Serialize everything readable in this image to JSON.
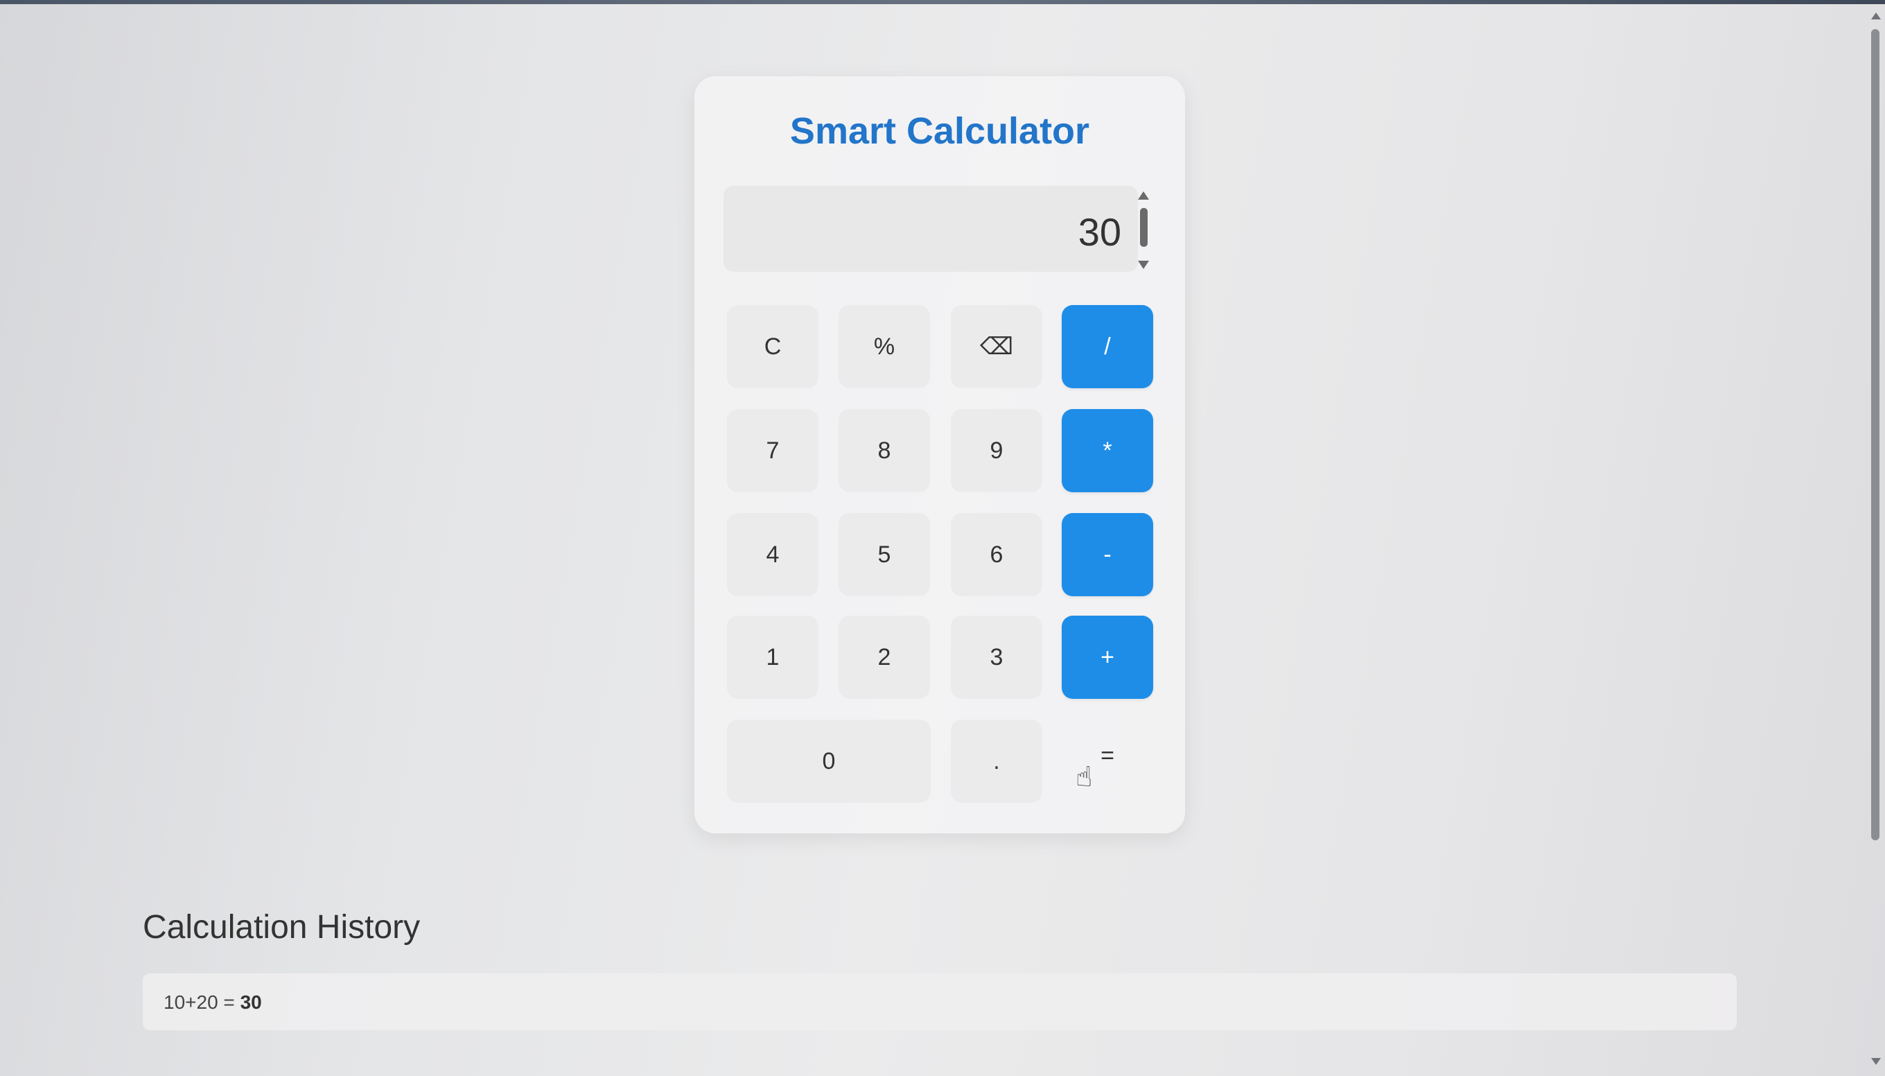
{
  "calculator": {
    "title": "Smart Calculator",
    "display_value": "30",
    "keys": {
      "clear": "C",
      "percent": "%",
      "backspace": "⌫",
      "divide": "/",
      "seven": "7",
      "eight": "8",
      "nine": "9",
      "multiply": "*",
      "four": "4",
      "five": "5",
      "six": "6",
      "subtract": "-",
      "one": "1",
      "two": "2",
      "three": "3",
      "add": "+",
      "zero": "0",
      "decimal": ".",
      "equals": "="
    },
    "colors": {
      "title": "#2275c9",
      "operator_key": "#1e8de8",
      "number_key": "#ebebec"
    }
  },
  "history": {
    "title": "Calculation History",
    "items": [
      {
        "expression": "10+20 =",
        "result": "30"
      }
    ]
  },
  "icons": {
    "backspace": "backspace-icon",
    "cursor": "hand-pointer-icon"
  }
}
